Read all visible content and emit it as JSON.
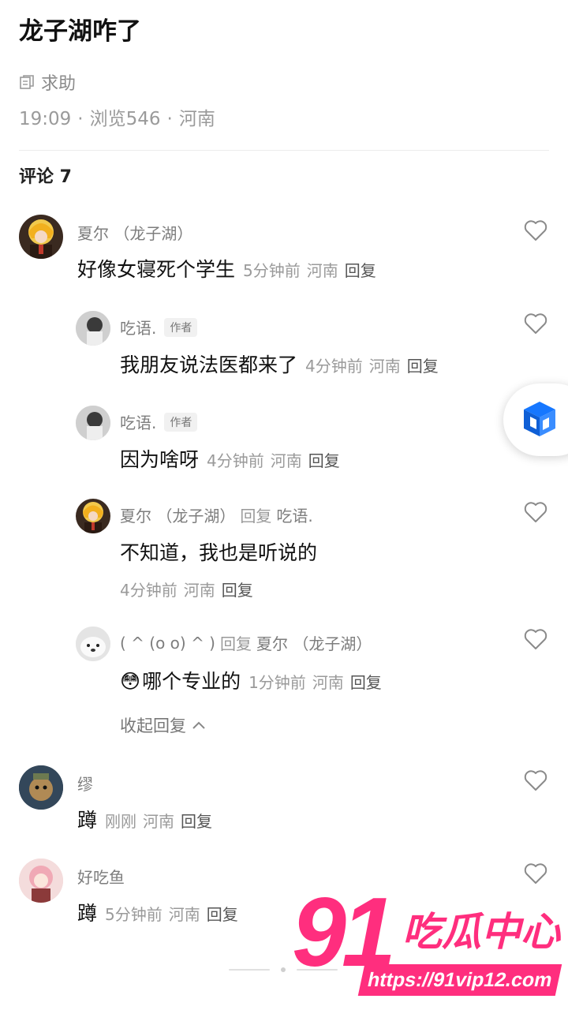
{
  "post": {
    "title": "龙子湖咋了",
    "tag": "求助",
    "time": "19:09",
    "views": "浏览546",
    "location": "河南",
    "meta_sep": "·"
  },
  "comments_header": "评论 7",
  "comments": [
    {
      "name": "夏尔 （龙子湖）",
      "text": "好像女寝死个学生",
      "time": "5分钟前",
      "loc": "河南",
      "reply": "回复"
    },
    {
      "name": "吃语.",
      "badge": "作者",
      "text": "我朋友说法医都来了",
      "time": "4分钟前",
      "loc": "河南",
      "reply": "回复"
    },
    {
      "name": "吃语.",
      "badge": "作者",
      "text": "因为啥呀",
      "time": "4分钟前",
      "loc": "河南",
      "reply": "回复"
    },
    {
      "name": "夏尔 （龙子湖）",
      "reply_word": "回复",
      "reply_to": "吃语.",
      "text": "不知道，我也是听说的",
      "time": "4分钟前",
      "loc": "河南",
      "reply": "回复"
    },
    {
      "name": "( ^ (o o) ^ )",
      "reply_word": "回复",
      "reply_to": "夏尔 （龙子湖）",
      "emoji": "😳",
      "text": "哪个专业的",
      "time": "1分钟前",
      "loc": "河南",
      "reply": "回复"
    },
    {
      "name": "缪",
      "text": "蹲",
      "time": "刚刚",
      "loc": "河南",
      "reply": "回复"
    },
    {
      "name": "好吃鱼",
      "text": "蹲",
      "time": "5分钟前",
      "loc": "河南",
      "reply": "回复"
    }
  ],
  "collapse_label": "收起回复",
  "watermark": {
    "number": "91",
    "text": "吃瓜中心",
    "url": "https://91vip12.com"
  },
  "icons": {
    "tag": "document-icon",
    "like": "heart-icon",
    "float": "cube-app-icon",
    "collapse": "chevron-up-icon"
  },
  "colors": {
    "watermark": "#ff2e7e",
    "float_icon": "#1677ff"
  }
}
